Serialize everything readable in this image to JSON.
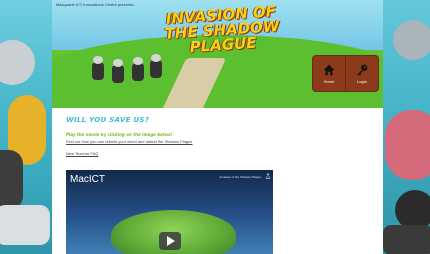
{
  "banner": {
    "presents": "Macquarie ICT Innovations Centre presents...",
    "title_line1": "INVASION OF",
    "title_line2": "THE SHADOW PLAGUE"
  },
  "nav": {
    "items": [
      {
        "label": "Home",
        "icon": "house-icon"
      },
      {
        "label": "Login",
        "icon": "key-icon"
      }
    ]
  },
  "content": {
    "heading": "WILL YOU SAVE US?",
    "subheading": "Play the movie by clicking on the image below!",
    "link_text": "Find out how you can rebuild your world and defeat the Shadow Plague",
    "faq_text": "New Teacher FAQ"
  },
  "video": {
    "title": "MacICT",
    "label": "Invasion of the Shadow Plague",
    "play_icon": "play-icon"
  },
  "colors": {
    "page_bg": "#3fb3c9",
    "nav_bg": "#8b3a1a",
    "heading": "#41b8d4",
    "subheading": "#7cba22",
    "title": "#f7d21a"
  }
}
